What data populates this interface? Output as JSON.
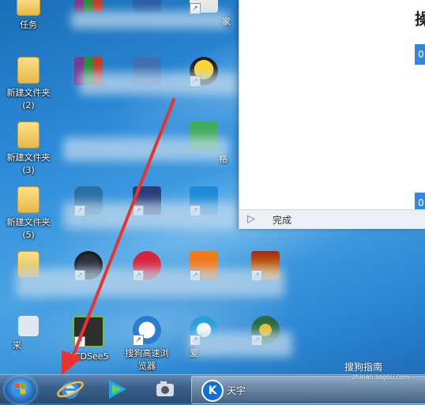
{
  "desktop": {
    "icons": [
      {
        "label": "任务"
      },
      {
        "label": "家"
      },
      {
        "label": "新建文件夹\n(2)"
      },
      {
        "label": "新建文件夹\n(3)"
      },
      {
        "label": "新建文件夹\n(5)"
      },
      {
        "label": "ACDSee5"
      },
      {
        "label": "搜狗高速浏\n览器"
      },
      {
        "label": "爱"
      },
      {
        "label": "格"
      },
      {
        "label": "来"
      }
    ]
  },
  "window": {
    "title_partial": "操",
    "badge_top": "0",
    "badge_bottom": "0",
    "status_text": "完成"
  },
  "taskbar": {
    "active_item_label": "天宇"
  },
  "watermark": {
    "brand": "搜狗指南",
    "url": "zhinan.sogou.com"
  },
  "colors": {
    "arrow": "#e8342c",
    "accent_blue": "#2f88e8",
    "taskbar": "#2a4c72"
  }
}
